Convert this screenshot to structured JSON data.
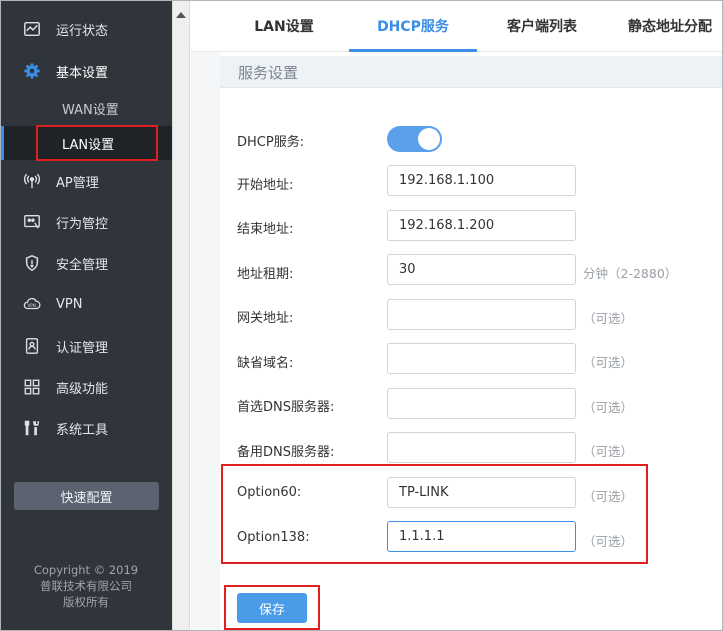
{
  "sidebar": {
    "items": [
      {
        "label": "运行状态",
        "icon": "chart-icon"
      },
      {
        "label": "基本设置",
        "icon": "gear-icon"
      },
      {
        "label": "AP管理",
        "icon": "wireless-ap-icon"
      },
      {
        "label": "行为管控",
        "icon": "behavior-control-icon"
      },
      {
        "label": "安全管理",
        "icon": "shield-icon"
      },
      {
        "label": "VPN",
        "icon": "vpn-cloud-icon"
      },
      {
        "label": "认证管理",
        "icon": "auth-badge-icon"
      },
      {
        "label": "高级功能",
        "icon": "grid-icon"
      },
      {
        "label": "系统工具",
        "icon": "tools-icon"
      }
    ],
    "subitems": [
      {
        "label": "WAN设置"
      },
      {
        "label": "LAN设置"
      }
    ],
    "quick_config": "快速配置",
    "copyright": [
      "Copyright © 2019",
      "普联技术有限公司",
      "版权所有"
    ]
  },
  "tabs": [
    {
      "label": "LAN设置"
    },
    {
      "label": "DHCP服务"
    },
    {
      "label": "客户端列表"
    },
    {
      "label": "静态地址分配"
    }
  ],
  "panel": {
    "title": "服务设置",
    "dhcp_label": "DHCP服务:",
    "rows": [
      {
        "label": "开始地址:",
        "value": "192.168.1.100",
        "hint": ""
      },
      {
        "label": "结束地址:",
        "value": "192.168.1.200",
        "hint": ""
      },
      {
        "label": "地址租期:",
        "value": "30",
        "hint": "分钟（2-2880）"
      },
      {
        "label": "网关地址:",
        "value": "",
        "hint": "（可选）"
      },
      {
        "label": "缺省域名:",
        "value": "",
        "hint": "（可选）"
      },
      {
        "label": "首选DNS服务器:",
        "value": "",
        "hint": "（可选）"
      },
      {
        "label": "备用DNS服务器:",
        "value": "",
        "hint": "（可选）"
      },
      {
        "label": "Option60:",
        "value": "TP-LINK",
        "hint": "（可选）"
      },
      {
        "label": "Option138:",
        "value": "1.1.1.1",
        "hint": "（可选）"
      }
    ],
    "save_label": "保存"
  },
  "colors": {
    "sidebar_bg": "#30343b",
    "accent": "#3a8ee6",
    "highlight_border": "#e02020"
  }
}
